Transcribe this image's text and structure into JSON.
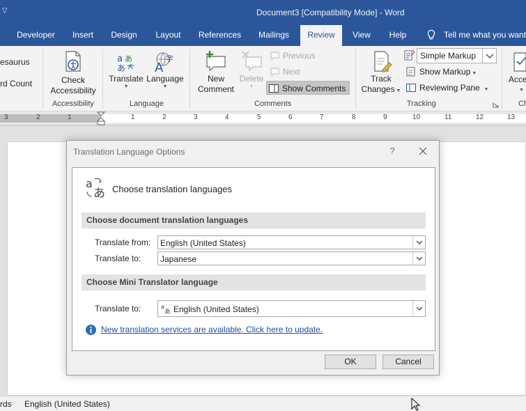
{
  "window": {
    "title": "Document3  [Compatibility Mode]  -  Word",
    "quick_access": "▽"
  },
  "tabs": [
    "Developer",
    "Insert",
    "Design",
    "Layout",
    "References",
    "Mailings",
    "Review",
    "View",
    "Help"
  ],
  "active_tab": "Review",
  "tell_me": "Tell me what you want to do",
  "ribbon": {
    "proofing": {
      "thesaurus": "esaurus",
      "word_count": "rd Count"
    },
    "accessibility": {
      "check_line1": "Check",
      "check_line2": "Accessibility",
      "group": "Accessibility"
    },
    "language": {
      "translate": "Translate",
      "language": "Language",
      "group": "Language"
    },
    "comments": {
      "new_line1": "New",
      "new_line2": "Comment",
      "delete": "Delete",
      "previous": "Previous",
      "next": "Next",
      "show_comments": "Show Comments",
      "group": "Comments"
    },
    "tracking": {
      "track_line1": "Track",
      "track_line2": "Changes",
      "markup_value": "Simple Markup",
      "show_markup": "Show Markup",
      "reviewing_pane": "Reviewing Pane",
      "group": "Tracking"
    },
    "accessibility_right": {
      "label": "Acce",
      "group": "Ch"
    }
  },
  "ruler": {
    "numbers": [
      "3",
      "2",
      "1",
      "1",
      "2",
      "3",
      "4",
      "5",
      "6",
      "7",
      "8",
      "9",
      "10",
      "11",
      "12",
      "13"
    ]
  },
  "status": {
    "words": "rds",
    "language": "English (United States)"
  },
  "dialog": {
    "title": "Translation Language Options",
    "help": "?",
    "heading": "Choose translation languages",
    "section_document": "Choose document translation languages",
    "translate_from_label": "Translate from:",
    "translate_from_value": "English (United States)",
    "translate_to_label": "Translate to:",
    "translate_to_value": "Japanese",
    "section_mini": "Choose Mini Translator language",
    "mini_to_label": "Translate to:",
    "mini_to_value": "English (United States)",
    "update_link": "New translation services are available.  Click here to update.",
    "ok": "OK",
    "cancel": "Cancel"
  }
}
